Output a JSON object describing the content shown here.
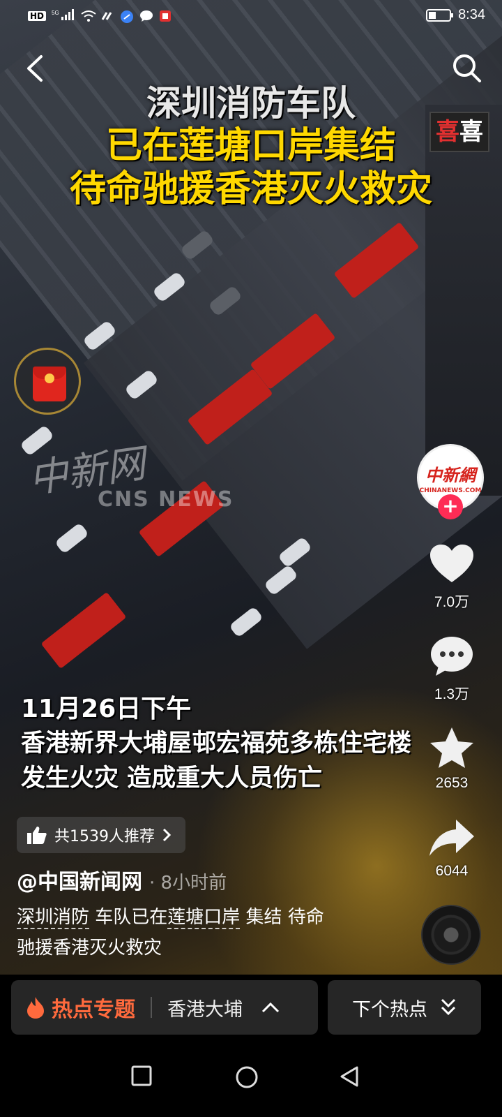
{
  "status_bar": {
    "network_badge": "HD",
    "signal_label": "5G",
    "time": "8:34",
    "battery_level": 0.35
  },
  "nav": {
    "back_icon": "chevron-left-icon",
    "search_icon": "search-icon"
  },
  "video": {
    "headline": {
      "line1": "深圳消防车队",
      "line2": "已在莲塘口岸集结",
      "line3": "待命驰援香港灭火救灾"
    },
    "store_sign": "喜",
    "watermark_cn": "中新网",
    "watermark_en": "CNS NEWS",
    "caption": {
      "line1": "11月26日下午",
      "line2": "香港新界大埔屋邨宏福苑多栋住宅楼",
      "line3": "发生火灾 造成重大人员伤亡"
    }
  },
  "author_avatar": {
    "logo_cn": "中新網",
    "logo_en": "CHINANEWS.COM"
  },
  "actions": {
    "likes": "7.0万",
    "comments": "1.3万",
    "favorites": "2653",
    "shares": "6044"
  },
  "recommend": {
    "label": "共1539人推荐"
  },
  "post": {
    "author": "@中国新闻网",
    "time_ago": "· 8小时前",
    "desc_kw1": "深圳消防",
    "desc_t1": " 车队已在",
    "desc_kw2": "莲塘口岸",
    "desc_t2": " 集结 待命",
    "desc_line2": "驰援香港灭火救灾"
  },
  "hot_bar": {
    "title": "热点专题",
    "topic": "香港大埔",
    "next_label": "下个热点"
  },
  "colors": {
    "accent_red": "#fe2c55",
    "headline_yellow": "#ffd800",
    "hot_orange": "#ff6a3d"
  }
}
